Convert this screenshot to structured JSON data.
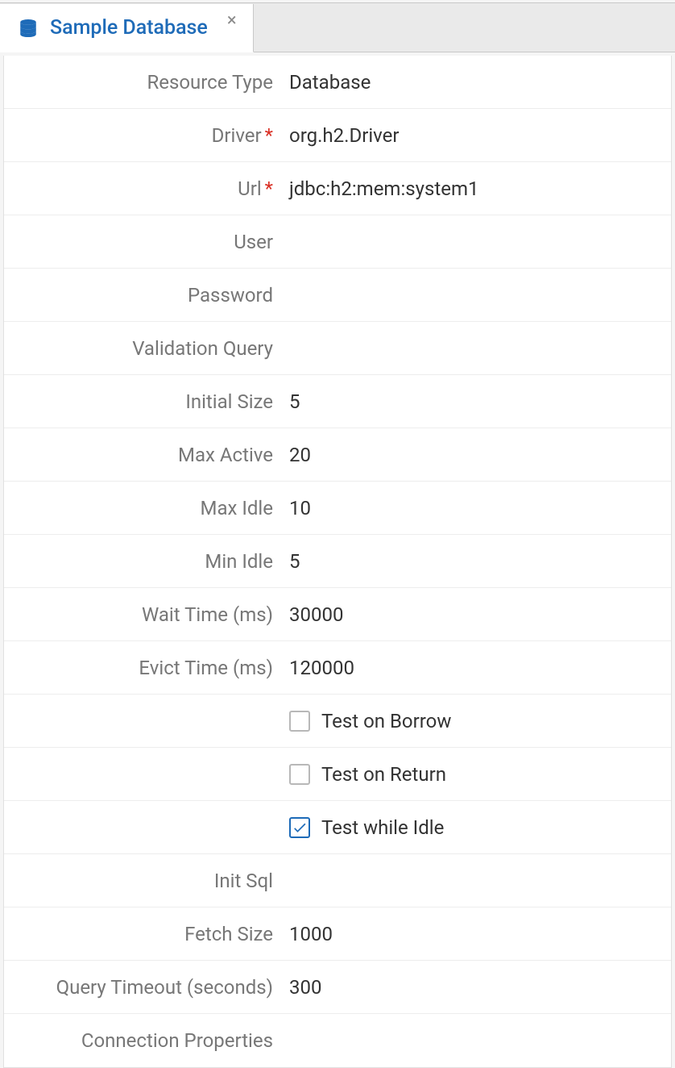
{
  "tab": {
    "title": "Sample Database"
  },
  "form": {
    "resource_type": {
      "label": "Resource Type",
      "value": "Database",
      "required": false
    },
    "driver": {
      "label": "Driver",
      "value": "org.h2.Driver",
      "required": true
    },
    "url": {
      "label": "Url",
      "value": "jdbc:h2:mem:system1",
      "required": true
    },
    "user": {
      "label": "User",
      "value": "",
      "required": false
    },
    "password": {
      "label": "Password",
      "value": "",
      "required": false
    },
    "validation_query": {
      "label": "Validation Query",
      "value": "",
      "required": false
    },
    "initial_size": {
      "label": "Initial Size",
      "value": "5",
      "required": false
    },
    "max_active": {
      "label": "Max Active",
      "value": "20",
      "required": false
    },
    "max_idle": {
      "label": "Max Idle",
      "value": "10",
      "required": false
    },
    "min_idle": {
      "label": "Min Idle",
      "value": "5",
      "required": false
    },
    "wait_time": {
      "label": "Wait Time (ms)",
      "value": "30000",
      "required": false
    },
    "evict_time": {
      "label": "Evict Time (ms)",
      "value": "120000",
      "required": false
    },
    "test_on_borrow": {
      "label": "Test on Borrow",
      "checked": false
    },
    "test_on_return": {
      "label": "Test on Return",
      "checked": false
    },
    "test_while_idle": {
      "label": "Test while Idle",
      "checked": true
    },
    "init_sql": {
      "label": "Init Sql",
      "value": "",
      "required": false
    },
    "fetch_size": {
      "label": "Fetch Size",
      "value": "1000",
      "required": false
    },
    "query_timeout": {
      "label": "Query Timeout (seconds)",
      "value": "300",
      "required": false
    },
    "connection_properties": {
      "label": "Connection Properties",
      "value": "",
      "required": false
    }
  }
}
